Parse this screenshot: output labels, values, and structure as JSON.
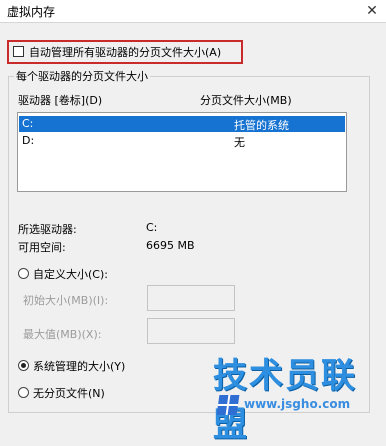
{
  "window": {
    "title": "虚拟内存"
  },
  "auto_manage": {
    "label": "自动管理所有驱动器的分页文件大小(A)",
    "checked": false
  },
  "group": {
    "title": "每个驱动器的分页文件大小",
    "col_drive": "驱动器 [卷标](D)",
    "col_size": "分页文件大小(MB)",
    "drives": [
      {
        "drive": "C:",
        "size": "托管的系统",
        "selected": true
      },
      {
        "drive": "D:",
        "size": "无",
        "selected": false
      }
    ]
  },
  "info": {
    "selected_drive_label": "所选驱动器:",
    "selected_drive_value": "C:",
    "free_space_label": "可用空间:",
    "free_space_value": "6695 MB"
  },
  "options": {
    "custom_size": "自定义大小(C):",
    "initial_size": "初始大小(MB)(I):",
    "max_size": "最大值(MB)(X):",
    "system_managed": "系统管理的大小(Y)",
    "no_paging": "无分页文件(N)",
    "selected": "system_managed"
  },
  "watermark": {
    "text": "技术员联盟",
    "url": "www.jsgho.com"
  },
  "colors": {
    "highlight_border": "#c92a2a",
    "selection": "#1773d1",
    "watermark": "#2e8fe0"
  }
}
